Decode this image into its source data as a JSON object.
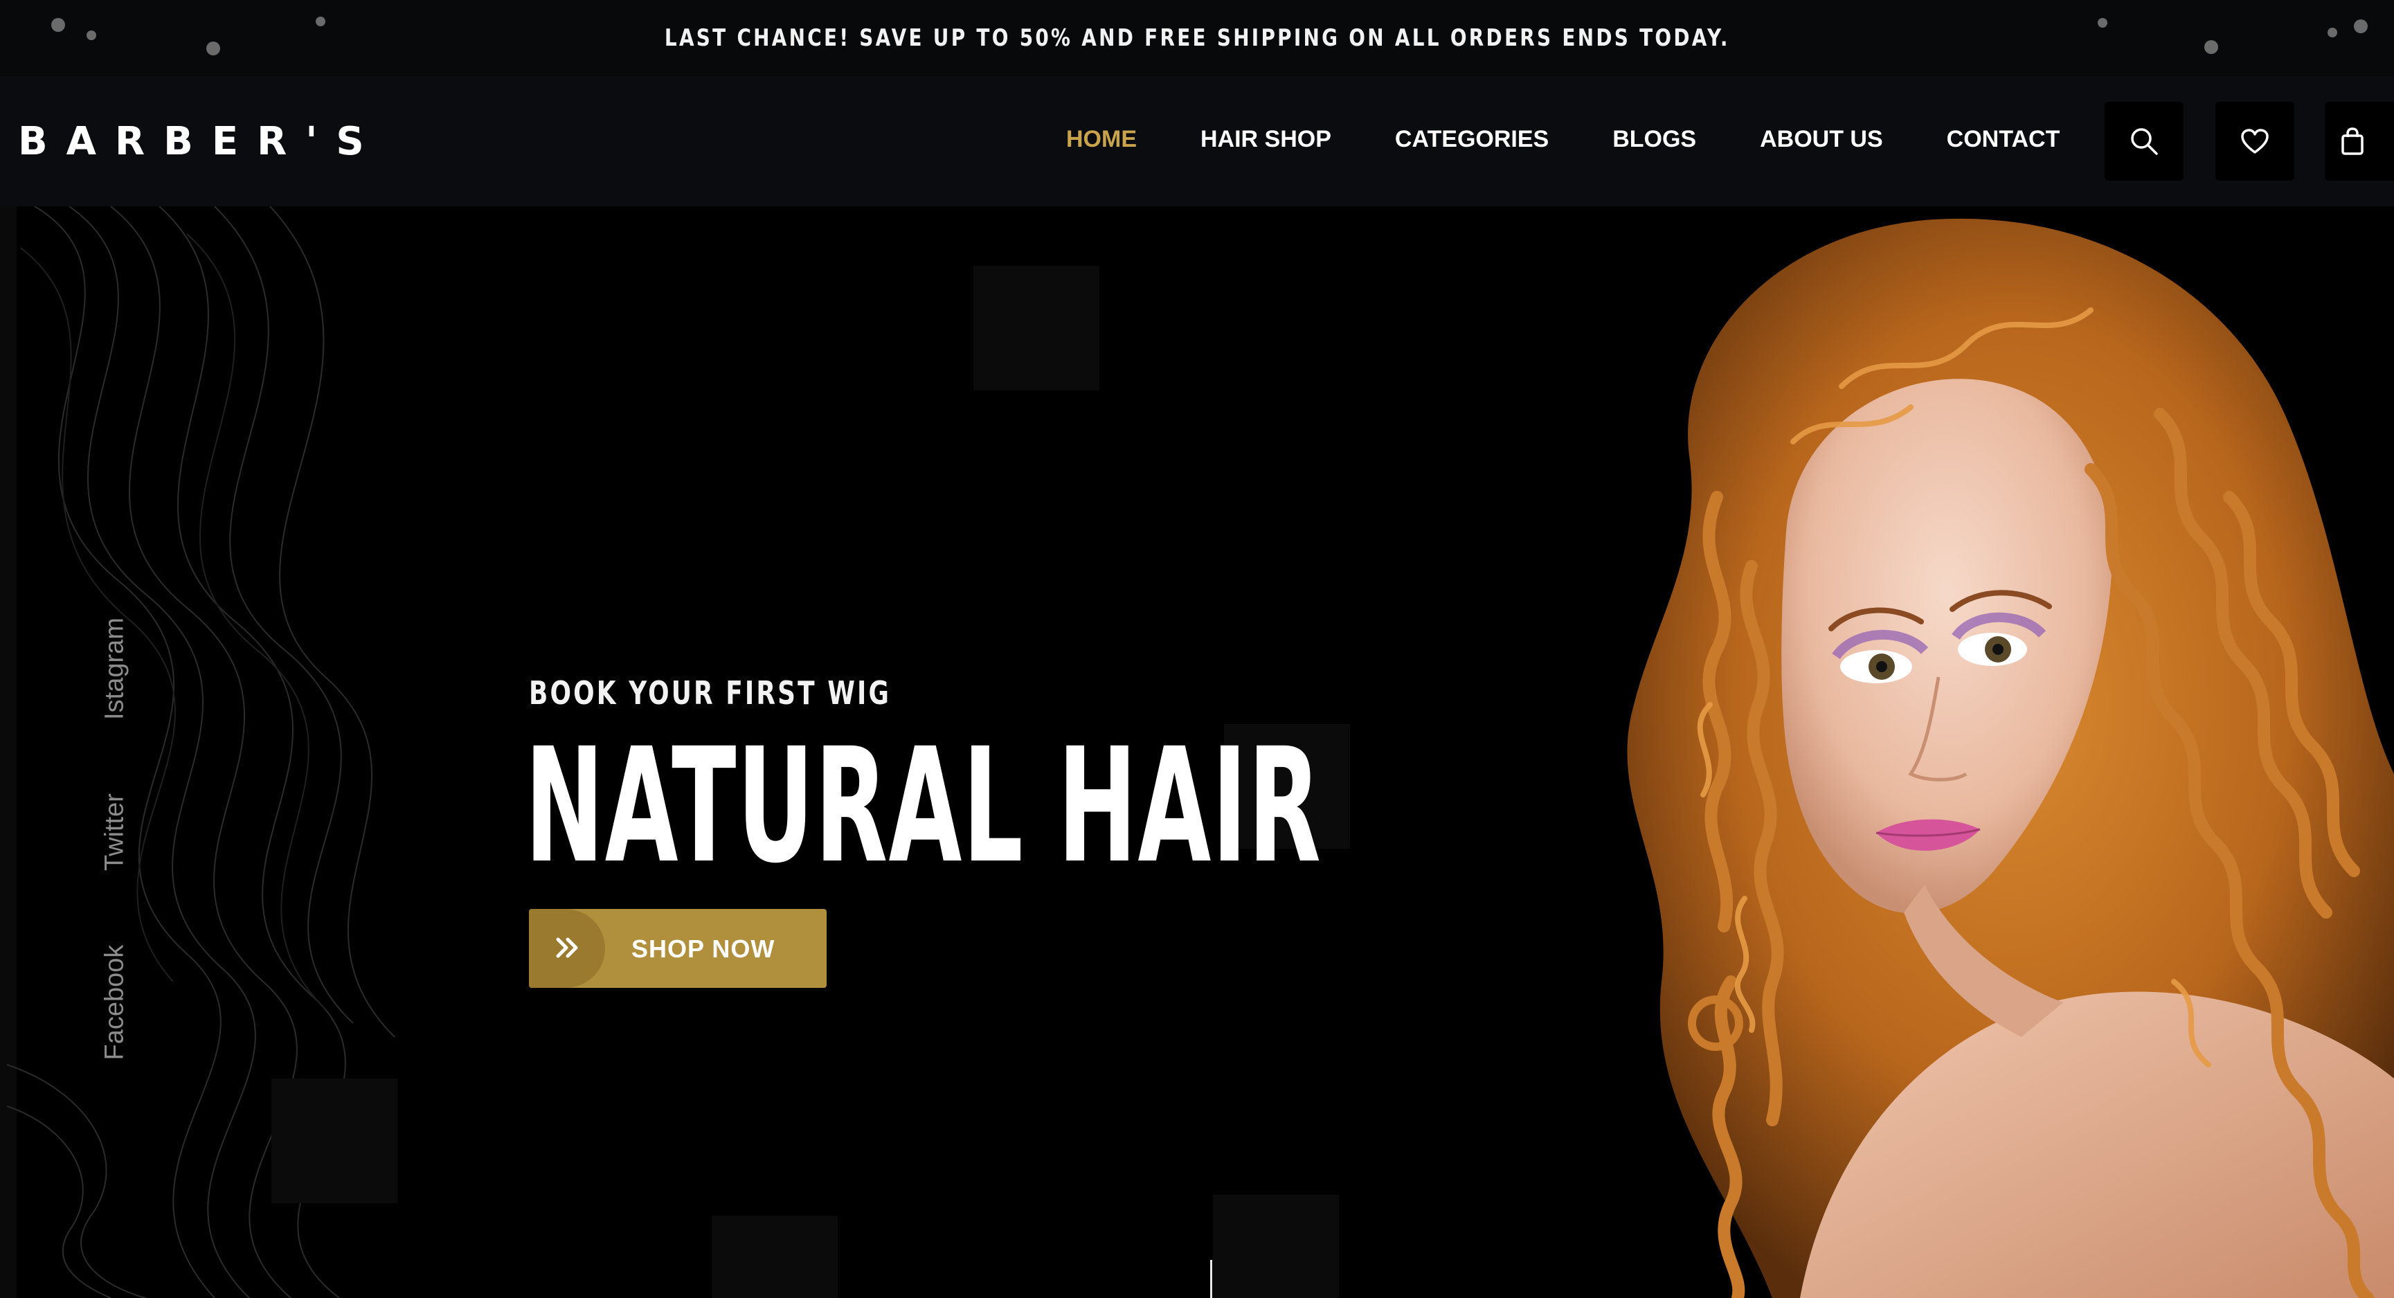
{
  "announcement": {
    "text": "LAST CHANCE! SAVE UP TO 50% AND FREE SHIPPING ON ALL ORDERS ENDS TODAY."
  },
  "header": {
    "logo": "BARBER'S",
    "nav": [
      {
        "label": "HOME",
        "active": true
      },
      {
        "label": "HAIR SHOP",
        "active": false
      },
      {
        "label": "CATEGORIES",
        "active": false
      },
      {
        "label": "BLOGS",
        "active": false
      },
      {
        "label": "ABOUT US",
        "active": false
      },
      {
        "label": "CONTACT",
        "active": false
      }
    ],
    "icons": [
      "search-icon",
      "heart-icon",
      "bag-icon"
    ]
  },
  "social": [
    {
      "label": "Istagram"
    },
    {
      "label": "Twitter"
    },
    {
      "label": "Facebook"
    }
  ],
  "hero": {
    "eyebrow": "BOOK YOUR FIRST WIG",
    "headline": "NATURAL HAIR",
    "cta_label": "SHOP NOW",
    "image_alt": "woman with long curly auburn hair"
  },
  "colors": {
    "accent": "#c9a44c",
    "button": "#b08f3d",
    "background": "#000000",
    "header_bg": "#0b0c0f"
  }
}
